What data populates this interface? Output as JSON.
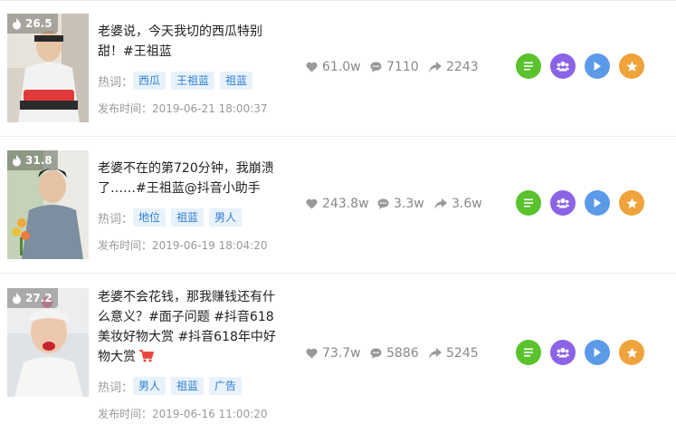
{
  "labels": {
    "hot_words": "热词：",
    "publish_time": "发布时间："
  },
  "colors": {
    "tag_bg": "#e8f2fc",
    "tag_text": "#2f7fd1",
    "btn_detail": "#5ac22c",
    "btn_fans": "#8a63e6",
    "btn_play": "#5b9ae8",
    "btn_star": "#f0a33a",
    "cart": "#e8423a"
  },
  "icons": {
    "heat": "fire-icon",
    "likes": "heart-icon",
    "comments": "comment-bubble-icon",
    "shares": "share-arrow-icon",
    "cart": "shopping-cart-icon",
    "actions": [
      "list-icon",
      "users-icon",
      "play-icon",
      "star-icon"
    ]
  },
  "videos": [
    {
      "heat": "26.5",
      "title_lines": [
        "老婆说，今天我切的西瓜特别",
        "甜！#王祖蓝"
      ],
      "tags": [
        "西瓜",
        "王祖蓝",
        "祖蓝"
      ],
      "date": "2019-06-21 18:00:37",
      "likes": "61.0w",
      "comments": "7110",
      "shares": "2243",
      "has_cart": false
    },
    {
      "heat": "31.8",
      "title_lines": [
        "老婆不在的第720分钟，我崩溃",
        "了……#王祖蓝@抖音小助手"
      ],
      "tags": [
        "地位",
        "祖蓝",
        "男人"
      ],
      "date": "2019-06-19 18:04:20",
      "likes": "243.8w",
      "comments": "3.3w",
      "shares": "3.6w",
      "has_cart": false
    },
    {
      "heat": "27.2",
      "title_lines": [
        "老婆不会花钱，那我赚钱还有什",
        "么意义？#面子问题 #抖音618",
        "美妆好物大赏 #抖音618年中好",
        "物大赏"
      ],
      "tags": [
        "男人",
        "祖蓝",
        "广告"
      ],
      "date": "2019-06-16 11:00:20",
      "likes": "73.7w",
      "comments": "5886",
      "shares": "5245",
      "has_cart": true
    }
  ]
}
